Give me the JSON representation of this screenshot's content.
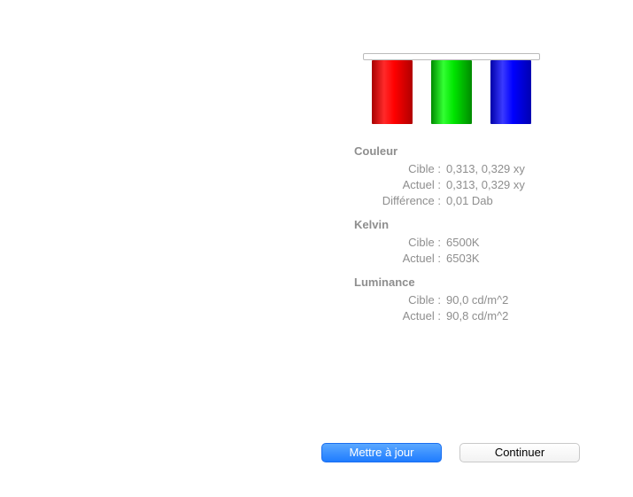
{
  "sections": {
    "couleur": {
      "title": "Couleur",
      "cible_label": "Cible :",
      "cible_value": "0,313, 0,329 xy",
      "actuel_label": "Actuel :",
      "actuel_value": "0,313, 0,329 xy",
      "diff_label": "Différence :",
      "diff_value": "0,01 Dab"
    },
    "kelvin": {
      "title": "Kelvin",
      "cible_label": "Cible :",
      "cible_value": "6500K",
      "actuel_label": "Actuel :",
      "actuel_value": "6503K"
    },
    "luminance": {
      "title": "Luminance",
      "cible_label": "Cible :",
      "cible_value": "90,0 cd/m^2",
      "actuel_label": "Actuel :",
      "actuel_value": "90,8 cd/m^2"
    }
  },
  "buttons": {
    "update": "Mettre à jour",
    "continue": "Continuer"
  },
  "chart_data": {
    "type": "bar",
    "title": "",
    "categories": [
      "R",
      "G",
      "B"
    ],
    "values": [
      100,
      100,
      100
    ],
    "colors": [
      "#ff0000",
      "#00e600",
      "#0000ff"
    ],
    "ylim": [
      0,
      100
    ]
  }
}
